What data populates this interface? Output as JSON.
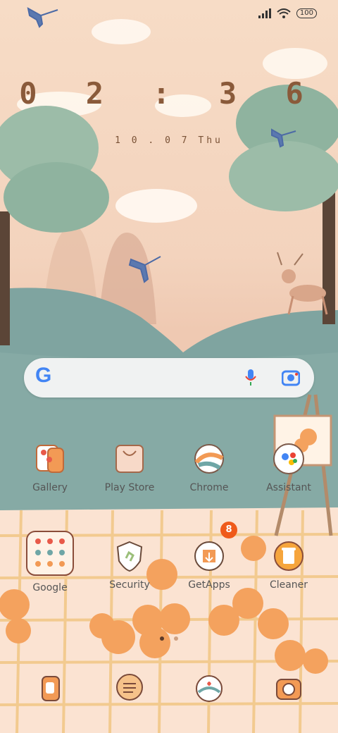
{
  "status_bar": {
    "battery": "100"
  },
  "clock": {
    "time": "0 2 : 3 6",
    "date": "1 0 . 0 7  Thu"
  },
  "search": {
    "mic_icon": "mic-icon",
    "lens_icon": "lens-icon",
    "logo": "G"
  },
  "row1": [
    {
      "label": "Gallery",
      "icon": "gallery-icon"
    },
    {
      "label": "Play Store",
      "icon": "play-store-icon"
    },
    {
      "label": "Chrome",
      "icon": "chrome-icon"
    },
    {
      "label": "Assistant",
      "icon": "assistant-icon"
    }
  ],
  "row2": [
    {
      "label": "Google",
      "icon": "google-folder-icon"
    },
    {
      "label": "Security",
      "icon": "security-icon"
    },
    {
      "label": "GetApps",
      "icon": "getapps-icon",
      "badge": "8"
    },
    {
      "label": "Cleaner",
      "icon": "cleaner-icon"
    }
  ],
  "dock": [
    {
      "icon": "phone-icon"
    },
    {
      "icon": "messages-icon"
    },
    {
      "icon": "themes-icon"
    },
    {
      "icon": "camera-icon"
    }
  ],
  "colors": {
    "sky": "#f3d3bd",
    "hill": "#7fa4a0",
    "tree": "#9cbca8",
    "cloth": "#fbe3d2",
    "accent_orange": "#f29a55",
    "badge": "#ef5a1a"
  }
}
